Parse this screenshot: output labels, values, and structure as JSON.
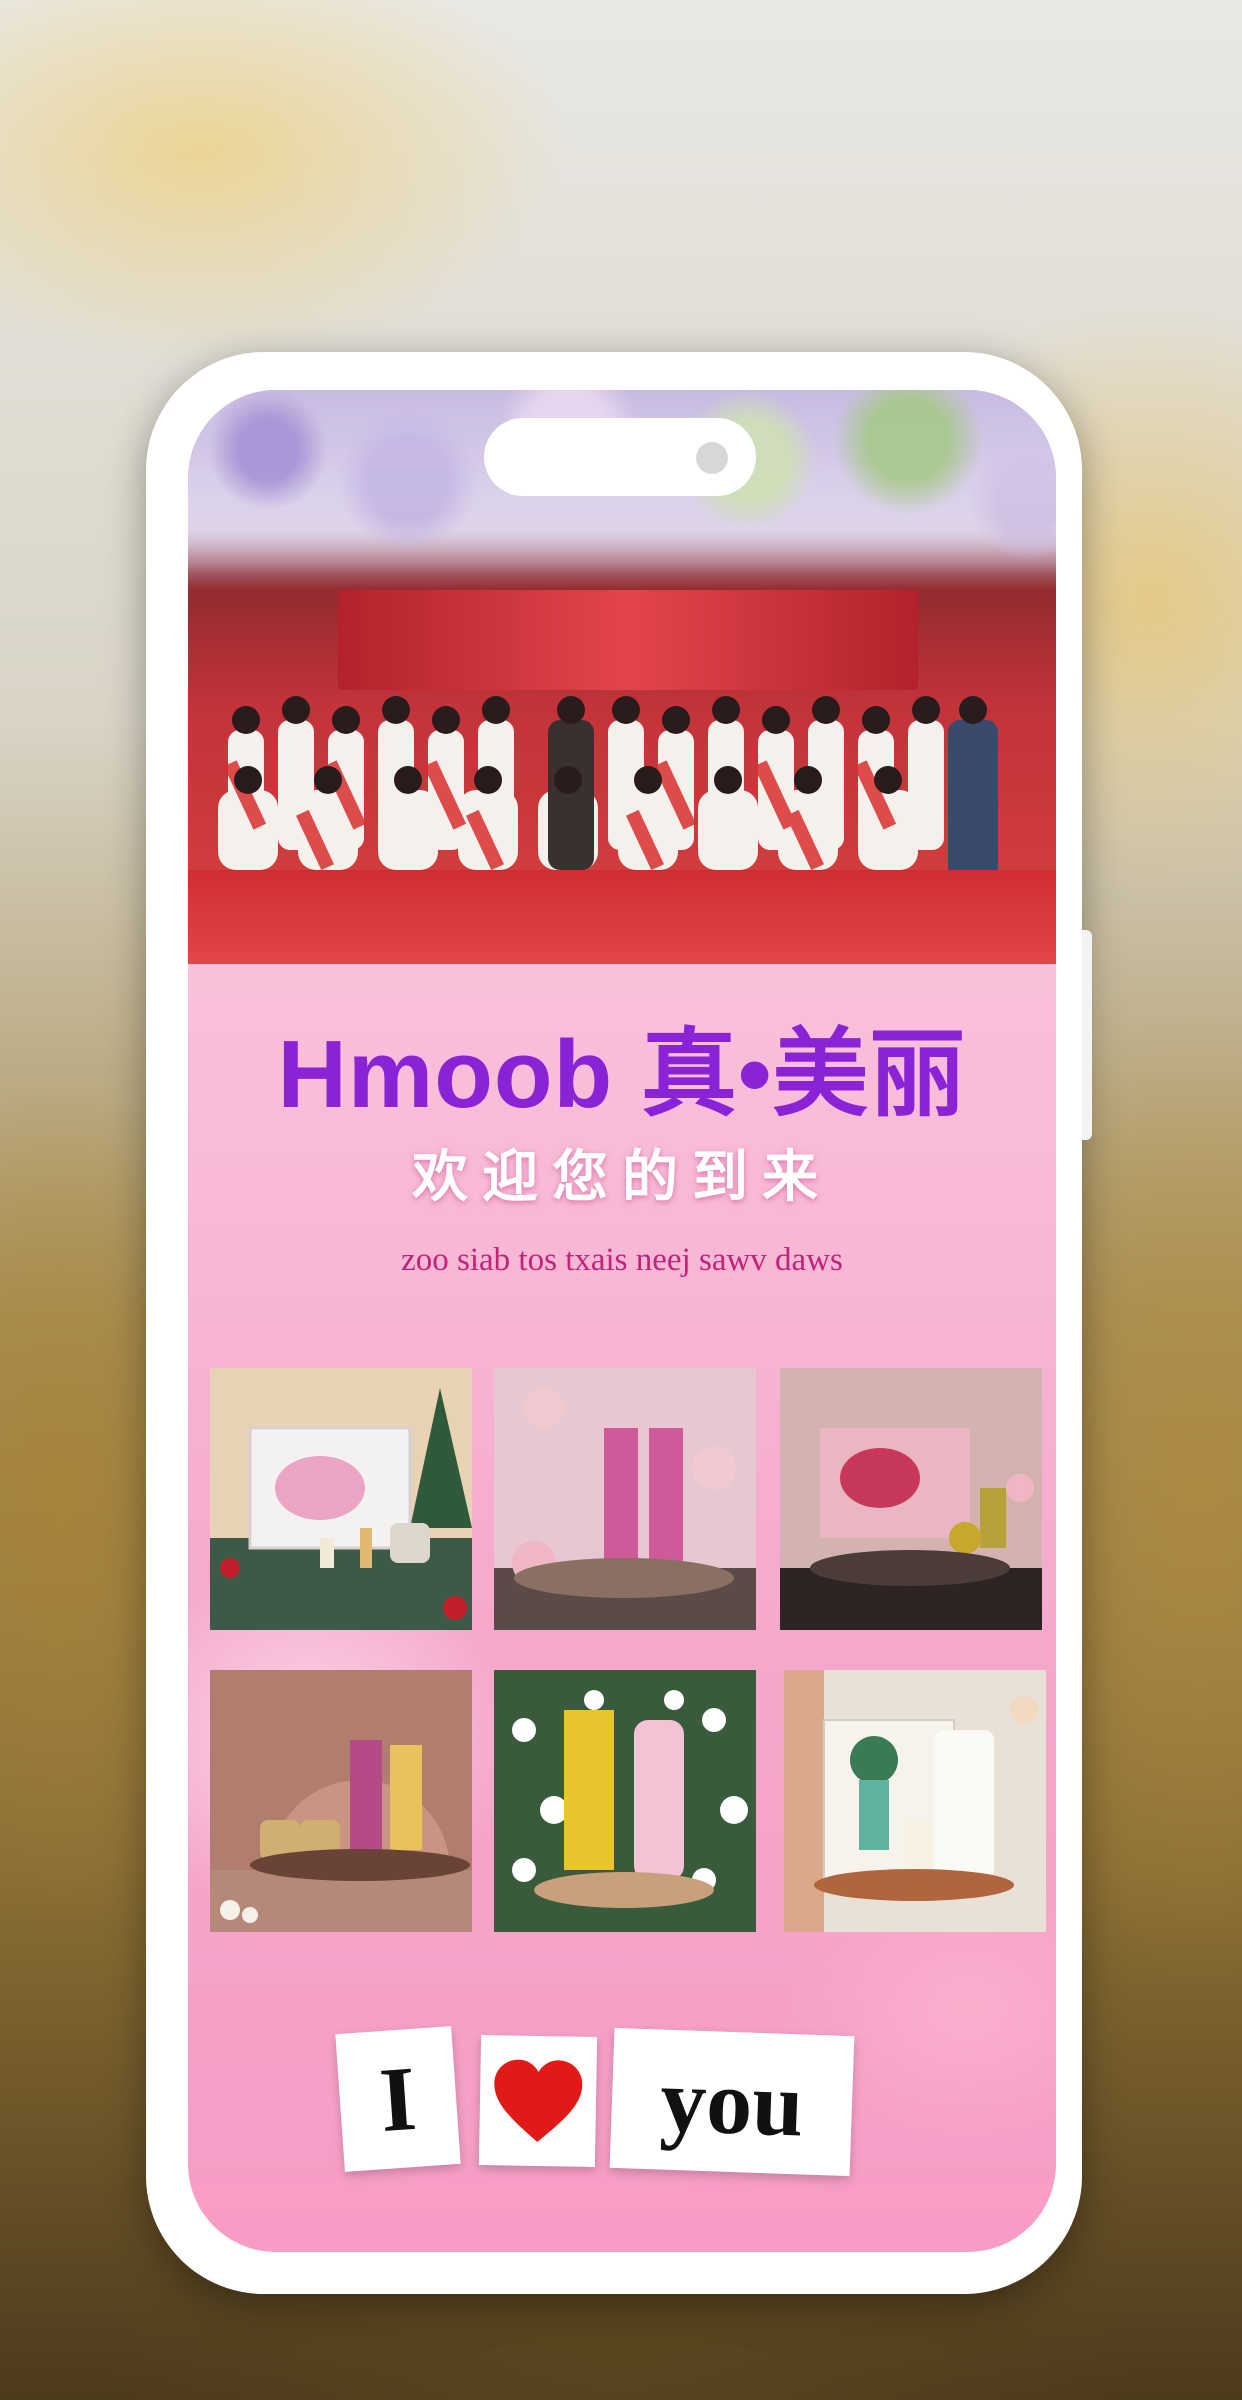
{
  "headline": "Hmoob 真•美丽",
  "welcome": "欢迎您的到来",
  "tagline": "zoo siab tos txais neej sawv daws",
  "love_cards": {
    "left": "I",
    "middle_icon": "heart-icon",
    "right": "you"
  },
  "hero_photo": "group-photo",
  "products": [
    {
      "name": "product-photo-1"
    },
    {
      "name": "product-photo-2"
    },
    {
      "name": "product-photo-3"
    },
    {
      "name": "product-photo-4"
    },
    {
      "name": "product-photo-5"
    },
    {
      "name": "product-photo-6"
    }
  ],
  "colors": {
    "headline": "#8a22d6",
    "tagline": "#c0237a",
    "heart": "#e01919",
    "screen_pink": "#f7a8cf"
  }
}
